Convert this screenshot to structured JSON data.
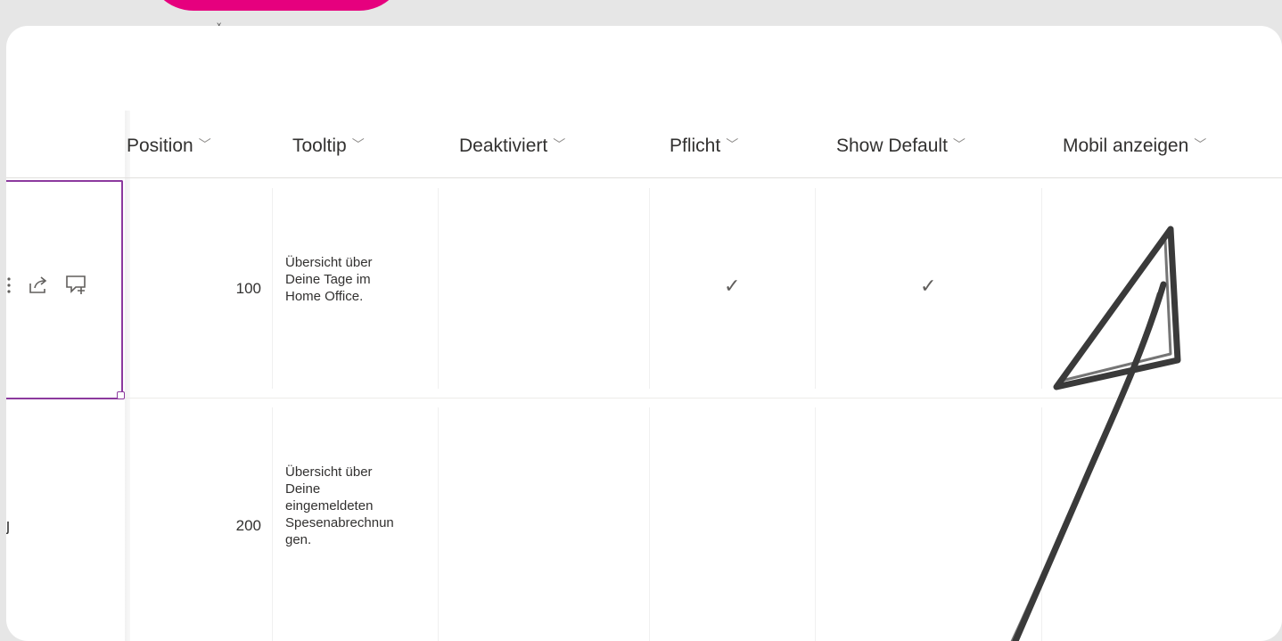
{
  "columns": [
    {
      "label": "Position"
    },
    {
      "label": "Tooltip"
    },
    {
      "label": "Deaktiviert"
    },
    {
      "label": "Pflicht"
    },
    {
      "label": "Show Default"
    },
    {
      "label": "Mobil anzeigen"
    }
  ],
  "rows": [
    {
      "position": "100",
      "tooltip": "Übersicht über Deine Tage im Home Office.",
      "tooltip_lines": [
        "Übersicht über",
        "Deine Tage im",
        "Home Office."
      ],
      "deaktiviert": "",
      "pflicht": "✓",
      "show_default": "✓",
      "mobil_anzeigen": ""
    },
    {
      "position": "200",
      "tooltip": "Übersicht über Deine eingemeldeten Spesenabrechnungen.",
      "tooltip_lines": [
        "Übersicht über",
        "Deine",
        "eingemeldeten",
        "Spesenabrechnun",
        "gen."
      ],
      "deaktiviert": "",
      "pflicht": "",
      "show_default": "",
      "mobil_anzeigen": ""
    }
  ],
  "row_action_icons": [
    "more-vertical-icon",
    "share-icon",
    "comment-add-icon"
  ],
  "accent_colors": {
    "brand_blob": "#e6007e",
    "selection": "#8c3a9e"
  },
  "annotation": {
    "type": "hand-drawn-arrow",
    "color": "#3a3a3a"
  }
}
